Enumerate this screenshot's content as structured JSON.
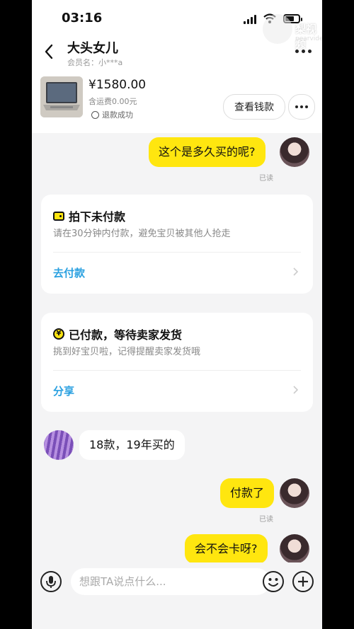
{
  "status_bar": {
    "time": "03:16"
  },
  "watermark": {
    "text": "梨视频",
    "sub": "pearvideo"
  },
  "header": {
    "title": "大头女儿",
    "member": "会员名：小***a"
  },
  "product": {
    "price": "¥1580.00",
    "shipping": "含运费0.00元",
    "status": "退款成功",
    "wallet_button": "查看钱款"
  },
  "messages": {
    "m1": "这个是多久买的呢?",
    "m1_read": "已读",
    "m2": "18款，19年买的",
    "m3": "付款了",
    "m3_read": "已读",
    "m4": "会不会卡呀?"
  },
  "cards": {
    "unpaid": {
      "title": "拍下未付款",
      "desc": "请在30分钟内付款，避免宝贝被其他人抢走",
      "action": "去付款",
      "icon": "wallet-icon"
    },
    "paid": {
      "title": "已付款，等待卖家发货",
      "desc": "挑到好宝贝啦，记得提醒卖家发货哦",
      "action": "分享",
      "icon": "yen-icon"
    }
  },
  "input": {
    "placeholder": "想跟TA说点什么..."
  },
  "colors": {
    "accent": "#ffe60f",
    "link": "#29a0e0",
    "background": "#f4f4f5"
  }
}
